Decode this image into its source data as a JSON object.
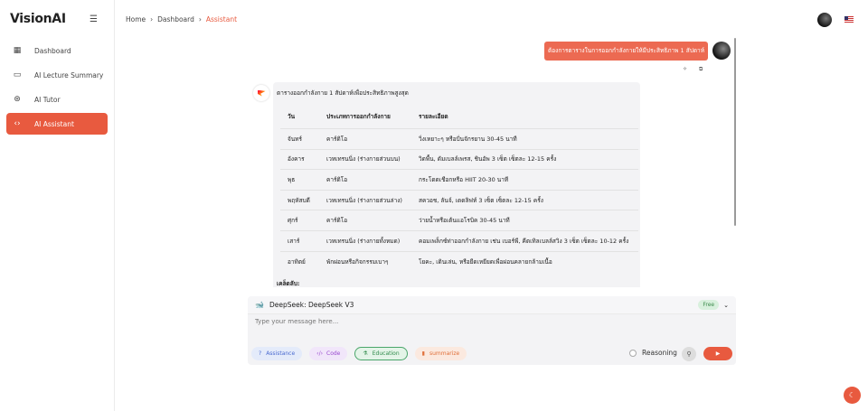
{
  "app": {
    "title": "VisionAI"
  },
  "sidebar": {
    "items": [
      {
        "label": "Dashboard",
        "icon": "grid-icon"
      },
      {
        "label": "AI Lecture Summary",
        "icon": "book-icon"
      },
      {
        "label": "AI Tutor",
        "icon": "brain-icon"
      },
      {
        "label": "AI Assistant",
        "icon": "code-icon",
        "active": true
      }
    ]
  },
  "breadcrumb": {
    "items": [
      "Home",
      "Dashboard",
      "Assistant"
    ]
  },
  "chat": {
    "user_message": "ต้องการตารางในการออกกำลังกายให้มีประสิทธิภาพ 1 สัปดาห์",
    "response": {
      "intro": "ตารางออกกำลังกาย 1 สัปดาห์เพื่อประสิทธิภาพสูงสุด",
      "headers": [
        "วัน",
        "ประเภทการออกกำลังกาย",
        "รายละเอียด"
      ],
      "rows": [
        [
          "จันทร์",
          "คาร์ดิโอ",
          "วิ่งเหยาะๆ หรือปั่นจักรยาน 30-45 นาที"
        ],
        [
          "อังคาร",
          "เวทเทรนนิ่ง (ร่างกายส่วนบน)",
          "วิดพื้น, ดัมเบลล์เพรส, ชินอัพ 3 เซ็ต เซ็ตละ 12-15 ครั้ง"
        ],
        [
          "พุธ",
          "คาร์ดิโอ",
          "กระโดดเชือกหรือ HIIT 20-30 นาที"
        ],
        [
          "พฤหัสบดี",
          "เวทเทรนนิ่ง (ร่างกายส่วนล่าง)",
          "สควอช, ลันจ์, เดดลิฟท์ 3 เซ็ต เซ็ตละ 12-15 ครั้ง"
        ],
        [
          "ศุกร์",
          "คาร์ดิโอ",
          "ว่ายน้ำหรือเต้นแอโรบิค 30-45 นาที"
        ],
        [
          "เสาร์",
          "เวทเทรนนิ่ง (ร่างกายทั้งหมด)",
          "คอมเพล็กซ์ท่าออกกำลังกาย เช่น เบอร์พี, คีตเทิลเบลล์สวิง 3 เซ็ต เซ็ตละ 10-12 ครั้ง"
        ],
        [
          "อาทิตย์",
          "พักผ่อนหรือกิจกรรมเบาๆ",
          "โยคะ, เดินเล่น, หรือยืดเหยียดเพื่อผ่อนคลายกล้ามเนื้อ"
        ]
      ],
      "tips_heading": "เคล็ดลับ:"
    }
  },
  "composer": {
    "model": "DeepSeek: DeepSeek V3",
    "badge": "Free",
    "placeholder": "Type your message here...",
    "chips": [
      "Assistance",
      "Code",
      "Education",
      "summarize"
    ],
    "reasoning_label": "Reasoning"
  },
  "colors": {
    "accent": "#e85a3f"
  }
}
